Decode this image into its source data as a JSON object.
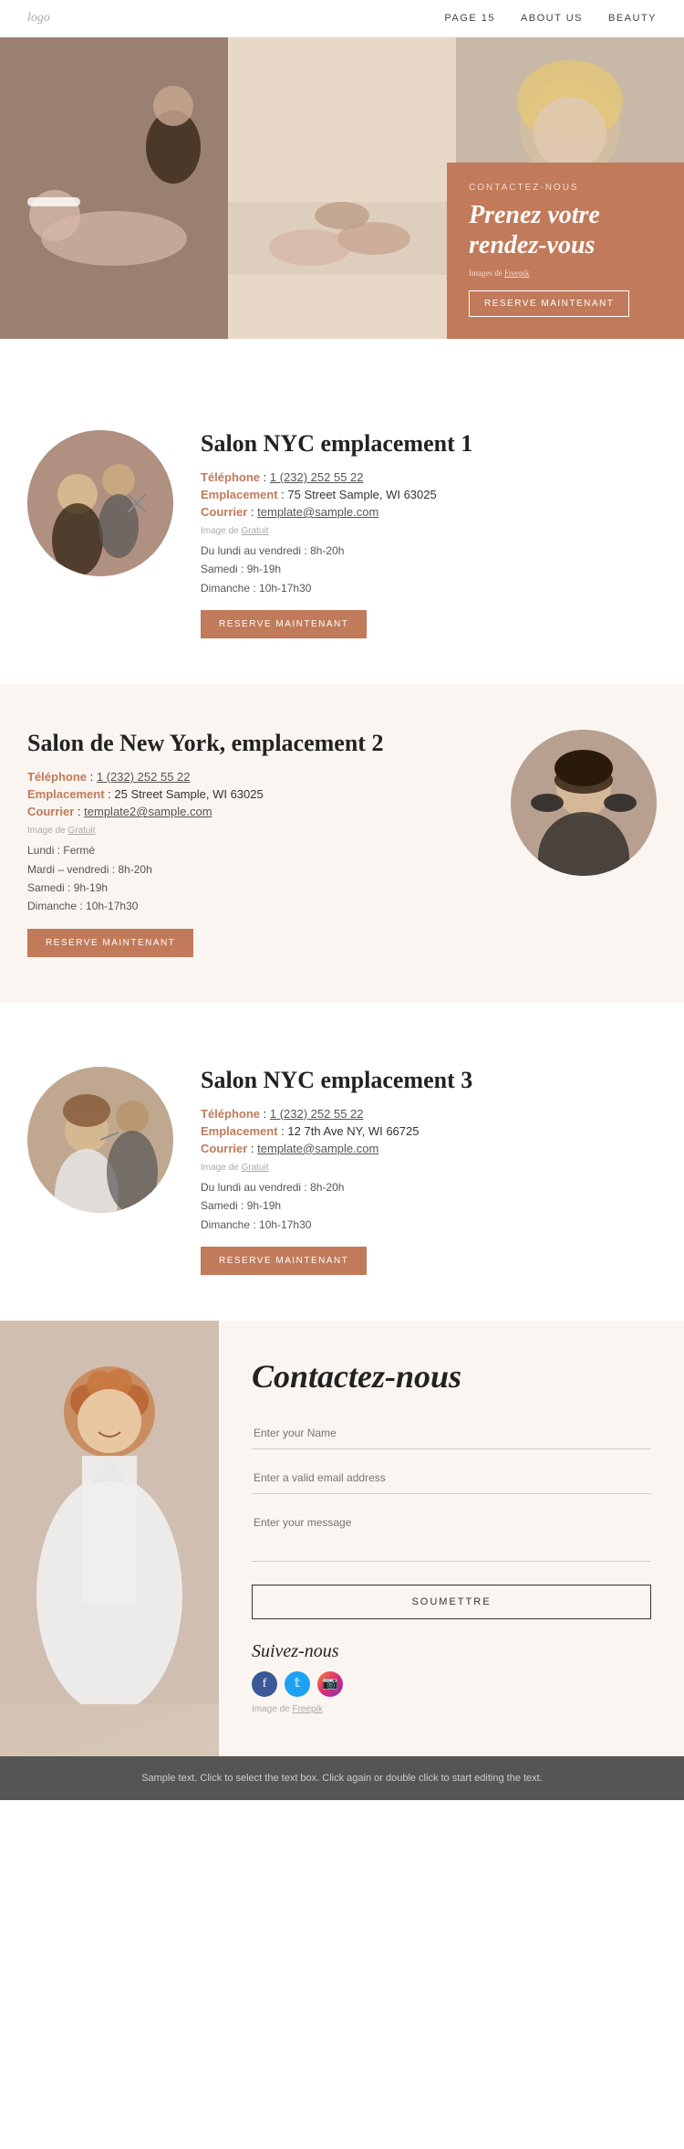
{
  "nav": {
    "logo": "logo",
    "links": [
      "PAGE 15",
      "ABOUT US",
      "BEAUTY"
    ]
  },
  "hero": {
    "contact_label": "CONTACTEZ-NOUS",
    "title": "Prenez votre rendez-vous",
    "img_credit": "Images de",
    "img_credit_link": "Freepik",
    "reserve_btn": "RESERVE MAINTENANT"
  },
  "location1": {
    "title": "Salon NYC emplacement 1",
    "phone_label": "Téléphone",
    "phone": "1 (232) 252 55 22",
    "address_label": "Emplacement",
    "address": "75 Street Sample, WI 63025",
    "email_label": "Courrier",
    "email": "template@sample.com",
    "img_credit": "Image de",
    "img_credit_link": "Gratuit",
    "hours": "Du lundi au vendredi : 8h-20h\nSamedi : 9h-19h\nDimanche : 10h-17h30",
    "reserve_btn": "RESERVE MAINTENANT"
  },
  "location2": {
    "title": "Salon de New York, emplacement 2",
    "phone_label": "Téléphone",
    "phone": "1 (232) 252 55 22",
    "address_label": "Emplacement",
    "address": "25 Street Sample, WI 63025",
    "email_label": "Courrier",
    "email": "template2@sample.com",
    "img_credit": "Image de",
    "img_credit_link": "Gratuit",
    "hours": "Lundi : Fermé\nMardi – vendredi : 8h-20h\nSamedi : 9h-19h\nDimanche : 10h-17h30",
    "reserve_btn": "RESERVE MAINTENANT"
  },
  "location3": {
    "title": "Salon NYC emplacement 3",
    "phone_label": "Téléphone",
    "phone": "1 (232) 252 55 22",
    "address_label": "Emplacement",
    "address": "12 7th Ave NY, WI 66725",
    "email_label": "Courrier",
    "email": "template@sample.com",
    "img_credit": "Image de",
    "img_credit_link": "Gratuit",
    "hours": "Du lundi au vendredi : 8h-20h\nSamedi : 9h-19h\nDimanche : 10h-17h30",
    "reserve_btn": "RESERVE MAINTENANT"
  },
  "contact": {
    "title": "Contactez-nous",
    "name_placeholder": "Enter your Name",
    "email_placeholder": "Enter a valid email address",
    "message_placeholder": "Enter your message",
    "submit_btn": "SOUMETTRE",
    "social_title": "Suivez-nous",
    "img_credit": "Image de",
    "img_credit_link": "Freepik"
  },
  "footer": {
    "text": "Sample text. Click to select the text box. Click again or double click to start editing the text."
  },
  "colors": {
    "accent": "#c17a5a",
    "beige_bg": "#faf5f0"
  }
}
